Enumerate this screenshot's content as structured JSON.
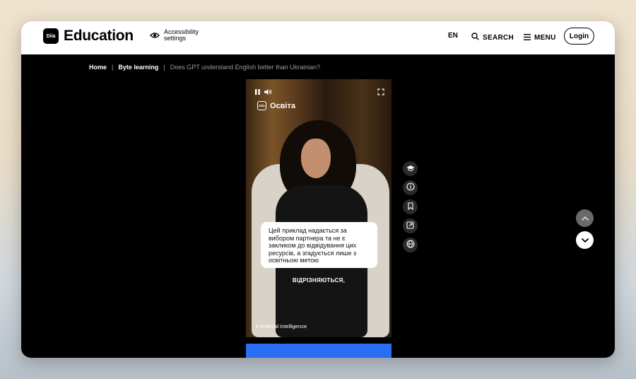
{
  "header": {
    "logo_mark": "Diia",
    "logo_text": "Education",
    "accessibility_label": "Accessibility settings",
    "language": "EN",
    "search_label": "SEARCH",
    "menu_label": "MENU",
    "login_label": "Login"
  },
  "breadcrumb": {
    "items": [
      "Home",
      "Byte learning"
    ],
    "current": "Does GPT understand English better than Ukrainian?"
  },
  "video": {
    "brand_mark": "Diia",
    "brand_name": "Освіта",
    "caption": "Цей приклад надається за вибором партнера та не є закликом до відвідування цих ресурсів, а згадується лише з освітньою метою",
    "subtitle": "ВІДРІЗНЯЮТЬСЯ,",
    "tag": "# Artificial Intelligence"
  },
  "side_actions": [
    "graduation-cap-icon",
    "info-icon",
    "bookmark-icon",
    "share-icon",
    "globe-icon"
  ],
  "colors": {
    "accent_blue": "#2a6ef5",
    "background": "#000000",
    "header": "#ffffff"
  }
}
